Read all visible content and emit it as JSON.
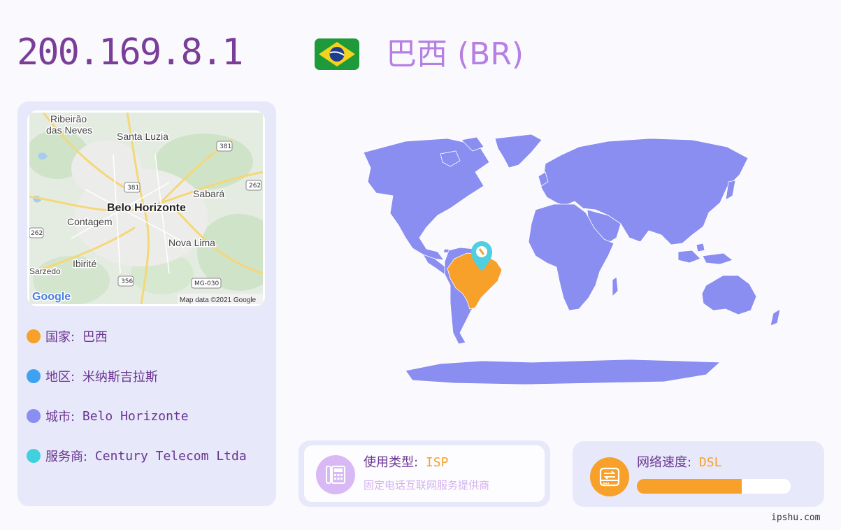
{
  "header": {
    "ip": "200.169.8.1",
    "flag_icon": "brazil-flag-icon",
    "country_title": "巴西 (BR)"
  },
  "colors": {
    "ip_text": "#7a3e98",
    "title_text": "#b67fe3",
    "panel_bg": "#e8e8fb",
    "map_land": "#8a8ef0",
    "highlight_country": "#f7a02a",
    "marker": "#4fcfdf",
    "dot_country": "#f7a02a",
    "dot_region": "#3fa2f0",
    "dot_city": "#8a8ef0",
    "dot_isp": "#3fd2de"
  },
  "local_map": {
    "labels": {
      "ribeirao": "Ribeirão",
      "das_neves": "das Neves",
      "santa_luzia": "Santa Luzia",
      "belo_horizonte": "Belo Horizonte",
      "sabara": "Sabará",
      "contagem": "Contagem",
      "nova_lima": "Nova Lima",
      "ibirite": "Ibirité",
      "sarzedo": "Sarzedo",
      "road_381_a": "381",
      "road_381_b": "381",
      "road_262_a": "262",
      "road_262_b": "262",
      "road_356": "356",
      "road_mg030": "MG-030"
    },
    "logo": "Google",
    "attribution": "Map data ©2021 Google"
  },
  "info": {
    "country": {
      "label": "国家:",
      "value": "巴西"
    },
    "region": {
      "label": "地区:",
      "value": "米纳斯吉拉斯"
    },
    "city": {
      "label": "城市:",
      "value": "Belo Horizonte"
    },
    "isp": {
      "label": "服务商:",
      "value": "Century Telecom Ltda"
    }
  },
  "usage": {
    "icon": "fax-phone-icon",
    "label": "使用类型:",
    "value": "ISP",
    "description": "固定电话互联网服务提供商"
  },
  "speed": {
    "icon": "hard-drive-transfer-icon",
    "label": "网络速度:",
    "value": "DSL",
    "level_percent": 68
  },
  "footer": {
    "site": "ipshu.com"
  }
}
